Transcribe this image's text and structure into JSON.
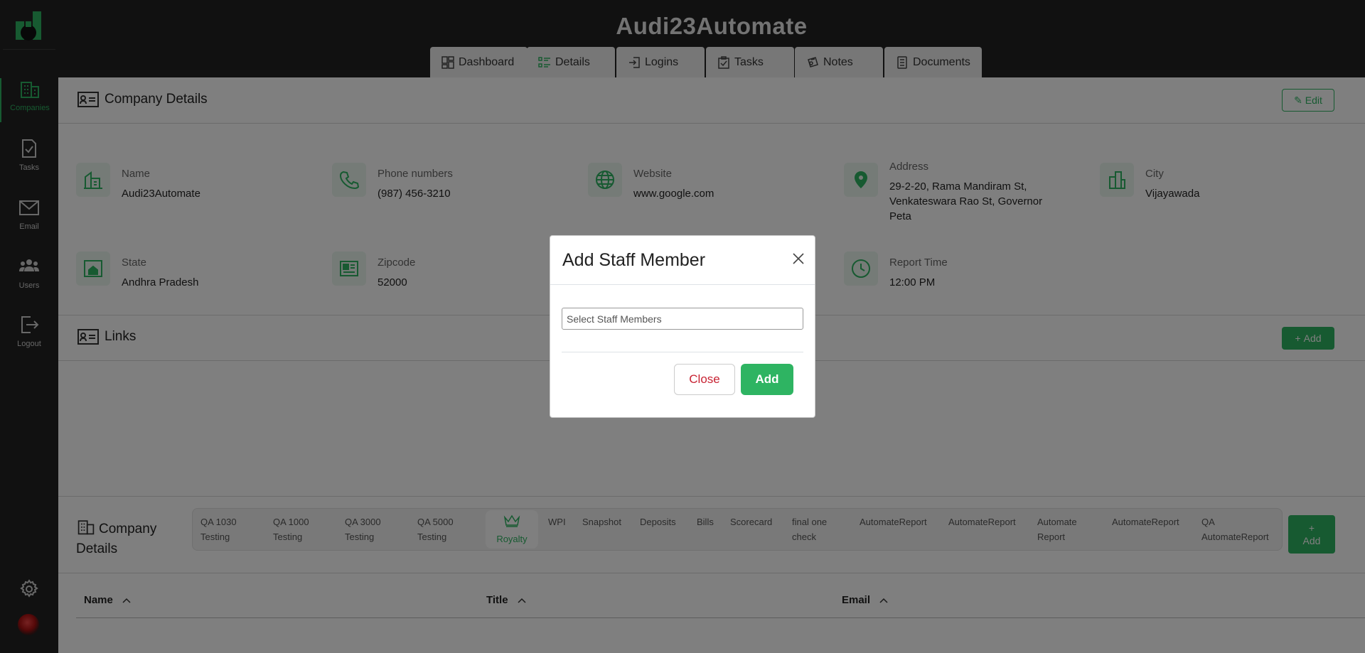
{
  "app": {
    "title": "Audi23Automate"
  },
  "colors": {
    "accent": "#2eb462",
    "sidebar_bg": "#222222",
    "close_text": "#c82333"
  },
  "sidebar": {
    "items": [
      {
        "label": "Companies",
        "icon": "building-icon",
        "active": true
      },
      {
        "label": "Tasks",
        "icon": "task-check-icon"
      },
      {
        "label": "Email",
        "icon": "envelope-icon"
      },
      {
        "label": "Users",
        "icon": "users-icon"
      },
      {
        "label": "Logout",
        "icon": "logout-icon"
      }
    ]
  },
  "tabs": [
    {
      "label": "Dashboard",
      "icon": "dashboard-icon"
    },
    {
      "label": "Details",
      "icon": "details-icon",
      "active": true
    },
    {
      "label": "Logins",
      "icon": "login-icon"
    },
    {
      "label": "Tasks",
      "icon": "clipboard-check-icon"
    },
    {
      "label": "Notes",
      "icon": "notes-icon"
    },
    {
      "label": "Documents",
      "icon": "documents-icon"
    }
  ],
  "company_details": {
    "title": "Company Details",
    "edit_label": "Edit",
    "fields": [
      {
        "label": "Name",
        "value": "Audi23Automate",
        "icon": "building-icon"
      },
      {
        "label": "Phone numbers",
        "value": "(987) 456-3210",
        "icon": "phone-icon"
      },
      {
        "label": "Website",
        "value": "www.google.com",
        "icon": "globe-icon"
      },
      {
        "label": "Address",
        "value": "29-2-20, Rama Mandiram St, Venkateswara Rao St, Governor Peta",
        "icon": "map-pin-icon"
      },
      {
        "label": "City",
        "value": "Vijayawada",
        "icon": "city-buildings-icon"
      },
      {
        "label": "State",
        "value": "Andhra Pradesh",
        "icon": "house-frame-icon"
      },
      {
        "label": "Zipcode",
        "value": "52000",
        "icon": "newspaper-icon"
      },
      {
        "label": "Report Time",
        "value": "12:00 PM",
        "icon": "clock-icon"
      }
    ]
  },
  "links": {
    "title": "Links",
    "add_label": "Add"
  },
  "bottom_section": {
    "title": "Company Details",
    "tabs": [
      "QA 1030 Testing",
      "QA 1000 Testing",
      "QA 3000 Testing",
      "QA 5000 Testing",
      "Royalty",
      "WPI",
      "Snapshot",
      "Deposits",
      "Bills",
      "Scorecard",
      "final one check",
      "AutomateReport",
      "AutomateReport",
      "Automate Report",
      "AutomateReport",
      "QA AutomateReport"
    ],
    "active_tab": "Royalty",
    "add_label": "Add",
    "columns": [
      "Name",
      "Title",
      "Email"
    ]
  },
  "modal": {
    "title": "Add Staff Member",
    "placeholder": "Select Staff Members",
    "close_label": "Close",
    "add_label": "Add"
  }
}
